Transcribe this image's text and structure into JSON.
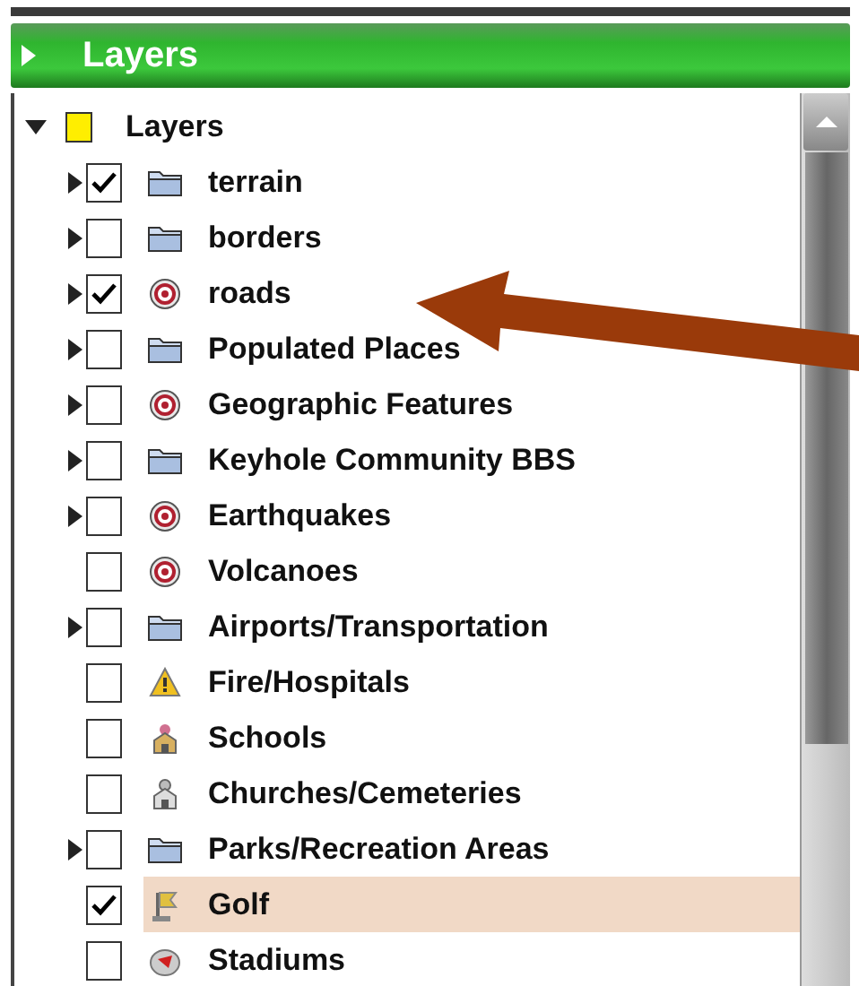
{
  "header": {
    "title": "Layers",
    "expanded": false
  },
  "tree": {
    "label": "Layers",
    "expanded": true,
    "kind": "square",
    "children": [
      {
        "label": "terrain",
        "expanded": false,
        "checked": true,
        "kind": "folder",
        "selected": false
      },
      {
        "label": "borders",
        "expanded": false,
        "checked": false,
        "kind": "folder",
        "selected": false
      },
      {
        "label": "roads",
        "expanded": false,
        "checked": true,
        "kind": "target",
        "selected": false
      },
      {
        "label": "Populated Places",
        "expanded": false,
        "checked": false,
        "kind": "folder",
        "selected": false
      },
      {
        "label": "Geographic Features",
        "expanded": false,
        "checked": false,
        "kind": "target",
        "selected": false
      },
      {
        "label": "Keyhole Community BBS",
        "expanded": false,
        "checked": false,
        "kind": "folder",
        "selected": false
      },
      {
        "label": "Earthquakes",
        "expanded": false,
        "checked": false,
        "kind": "target",
        "selected": false
      },
      {
        "label": "Volcanoes",
        "checked": false,
        "kind": "target",
        "selected": false
      },
      {
        "label": "Airports/Transportation",
        "expanded": false,
        "checked": false,
        "kind": "folder",
        "selected": false
      },
      {
        "label": "Fire/Hospitals",
        "checked": false,
        "kind": "warning",
        "selected": false
      },
      {
        "label": "Schools",
        "checked": false,
        "kind": "school",
        "selected": false
      },
      {
        "label": "Churches/Cemeteries",
        "checked": false,
        "kind": "church",
        "selected": false
      },
      {
        "label": "Parks/Recreation Areas",
        "expanded": false,
        "checked": false,
        "kind": "folder",
        "selected": false
      },
      {
        "label": "Golf",
        "checked": true,
        "kind": "golf",
        "selected": true
      },
      {
        "label": "Stadiums",
        "checked": false,
        "kind": "stadium",
        "selected": false
      }
    ]
  }
}
